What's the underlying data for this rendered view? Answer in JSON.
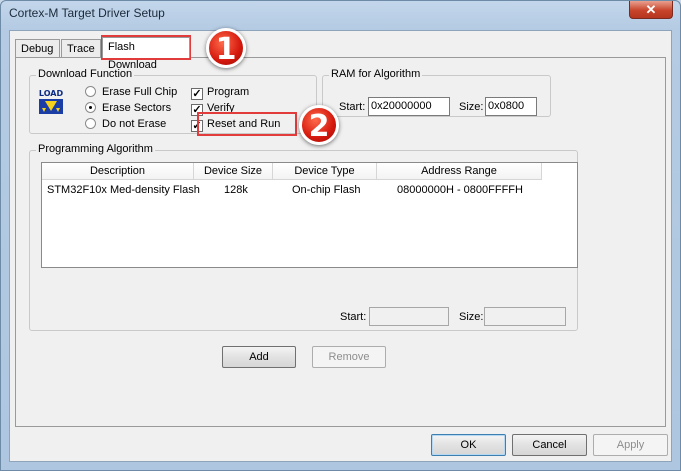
{
  "window": {
    "title": "Cortex-M Target Driver Setup",
    "close_glyph": "✕"
  },
  "tabs": [
    {
      "label": "Debug"
    },
    {
      "label": "Trace"
    },
    {
      "label": "Flash Download",
      "active": true
    }
  ],
  "download_function": {
    "title": "Download Function",
    "icon": "load-icon",
    "icon_text": "LOAD",
    "options": [
      {
        "label": "Erase Full Chip",
        "selected": false
      },
      {
        "label": "Erase Sectors",
        "selected": true
      },
      {
        "label": "Do not Erase",
        "selected": false
      }
    ],
    "checks": [
      {
        "label": "Program",
        "checked": true
      },
      {
        "label": "Verify",
        "checked": true
      },
      {
        "label": "Reset and Run",
        "checked": true
      }
    ]
  },
  "ram": {
    "title": "RAM for Algorithm",
    "start_label": "Start:",
    "start_value": "0x20000000",
    "size_label": "Size:",
    "size_value": "0x0800"
  },
  "programming": {
    "title": "Programming Algorithm",
    "columns": [
      "Description",
      "Device Size",
      "Device Type",
      "Address Range"
    ],
    "rows": [
      [
        "STM32F10x Med-density Flash",
        "128k",
        "On-chip Flash",
        "08000000H - 0800FFFFH"
      ]
    ],
    "start_label": "Start:",
    "start_value": "",
    "size_label": "Size:",
    "size_value": ""
  },
  "buttons": {
    "add": "Add",
    "remove": "Remove",
    "ok": "OK",
    "cancel": "Cancel",
    "apply": "Apply"
  },
  "annotations": [
    {
      "number": "1",
      "color": "#d4180d"
    },
    {
      "number": "2",
      "color": "#d4180d"
    }
  ]
}
